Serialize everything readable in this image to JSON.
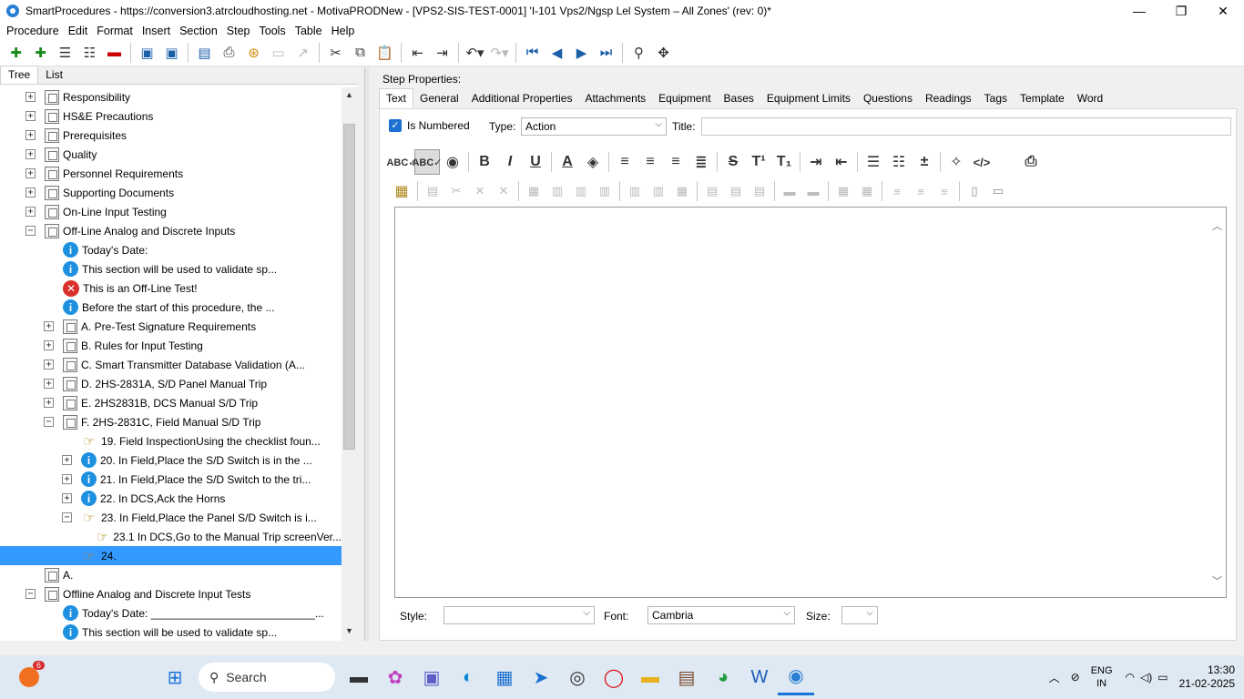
{
  "window": {
    "title": "SmartProcedures - https://conversion3.atrcloudhosting.net - MotivaPRODNew - [VPS2-SIS-TEST-0001] 'I-101 Vps2/Ngsp Lel System – All Zones' (rev: 0)*",
    "minimize": "—",
    "restore": "❐",
    "close": "✕"
  },
  "menu": [
    "Procedure",
    "Edit",
    "Format",
    "Insert",
    "Section",
    "Step",
    "Tools",
    "Table",
    "Help"
  ],
  "left_tabs": [
    "Tree",
    "List"
  ],
  "tree": [
    {
      "label": "Responsibility",
      "level": 0,
      "icon": "doc",
      "exp": "+"
    },
    {
      "label": "HS&E Precautions",
      "level": 0,
      "icon": "doc",
      "exp": "+"
    },
    {
      "label": "Prerequisites",
      "level": 0,
      "icon": "doc",
      "exp": "+"
    },
    {
      "label": "Quality",
      "level": 0,
      "icon": "doc",
      "exp": "+"
    },
    {
      "label": "Personnel Requirements",
      "level": 0,
      "icon": "doc",
      "exp": "+"
    },
    {
      "label": "Supporting Documents",
      "level": 0,
      "icon": "doc",
      "exp": "+"
    },
    {
      "label": "On-Line Input Testing",
      "level": 0,
      "icon": "doc",
      "exp": "+"
    },
    {
      "label": "Off-Line Analog and Discrete Inputs",
      "level": 0,
      "icon": "doc",
      "exp": "−"
    },
    {
      "label": "Today's Date:",
      "level": 1,
      "icon": "info",
      "exp": ""
    },
    {
      "label": "This section will be used to validate sp...",
      "level": 1,
      "icon": "info",
      "exp": ""
    },
    {
      "label": "This is an Off-Line Test!",
      "level": 1,
      "icon": "err",
      "exp": ""
    },
    {
      "label": "Before the start of this procedure, the ...",
      "level": 1,
      "icon": "info",
      "exp": ""
    },
    {
      "label": "A. Pre-Test Signature Requirements",
      "level": 1,
      "icon": "doc",
      "exp": "+"
    },
    {
      "label": "B. Rules for Input Testing",
      "level": 1,
      "icon": "doc",
      "exp": "+"
    },
    {
      "label": "C. Smart Transmitter Database Validation (A...",
      "level": 1,
      "icon": "doc",
      "exp": "+"
    },
    {
      "label": "D. 2HS-2831A, S/D Panel Manual Trip",
      "level": 1,
      "icon": "doc",
      "exp": "+"
    },
    {
      "label": "E. 2HS2831B, DCS Manual S/D Trip",
      "level": 1,
      "icon": "doc",
      "exp": "+"
    },
    {
      "label": "F. 2HS-2831C, Field Manual S/D Trip",
      "level": 1,
      "icon": "doc",
      "exp": "−"
    },
    {
      "label": "19. Field InspectionUsing the checklist foun...",
      "level": 2,
      "icon": "hand",
      "exp": ""
    },
    {
      "label": "20. In Field,Place the S/D Switch is in the ...",
      "level": 2,
      "icon": "info",
      "exp": "+"
    },
    {
      "label": "21. In Field,Place the S/D Switch to the tri...",
      "level": 2,
      "icon": "info",
      "exp": "+"
    },
    {
      "label": "22. In DCS,Ack the Horns",
      "level": 2,
      "icon": "info",
      "exp": "+"
    },
    {
      "label": "23. In Field,Place the Panel S/D Switch is i...",
      "level": 2,
      "icon": "hand",
      "exp": "−"
    },
    {
      "label": "23.1 In DCS,Go to the Manual Trip screenVer...",
      "level": 3,
      "icon": "hand",
      "exp": ""
    },
    {
      "label": "24.",
      "level": 2,
      "icon": "hand",
      "exp": "",
      "selected": true
    },
    {
      "label": "A.",
      "level": 0,
      "icon": "doc",
      "exp": ""
    },
    {
      "label": "Offline Analog and Discrete Input Tests",
      "level": 0,
      "icon": "doc",
      "exp": "−"
    },
    {
      "label": "Today's Date: ___________________________...",
      "level": 1,
      "icon": "info",
      "exp": ""
    },
    {
      "label": "This section will be used to validate sp...",
      "level": 1,
      "icon": "info",
      "exp": ""
    }
  ],
  "step_properties": {
    "heading": "Step Properties:",
    "tabs": [
      "Text",
      "General",
      "Additional Properties",
      "Attachments",
      "Equipment",
      "Bases",
      "Equipment Limits",
      "Questions",
      "Readings",
      "Tags",
      "Template",
      "Word"
    ],
    "is_numbered_label": "Is Numbered",
    "type_label": "Type:",
    "type_value": "Action",
    "title_label": "Title:",
    "title_value": "",
    "style_label": "Style:",
    "style_value": "",
    "font_label": "Font:",
    "font_value": "Cambria",
    "size_label": "Size:",
    "size_value": ""
  },
  "taskbar": {
    "search_placeholder": "Search",
    "notification_count": "6",
    "lang_line1": "ENG",
    "lang_line2": "IN",
    "time": "13:30",
    "date": "21-02-2025"
  }
}
